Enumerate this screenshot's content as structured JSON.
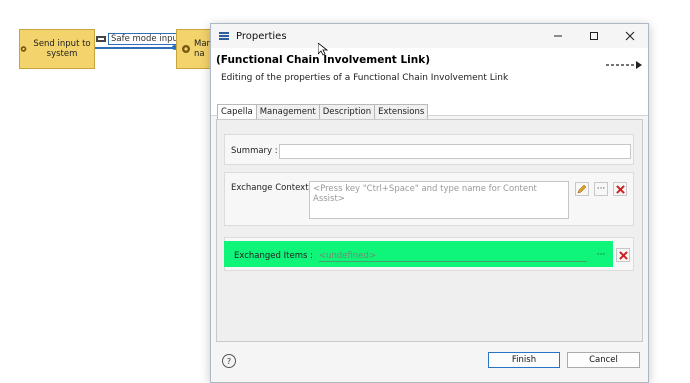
{
  "diagram": {
    "node1_label": "Send input to system",
    "node2_label": "Man\nna",
    "edge_label": "Safe mode input"
  },
  "dialog": {
    "title": "Properties",
    "header_title": "(Functional Chain Involvement Link)",
    "header_desc": "Editing of the properties of a Functional Chain Involvement Link",
    "tabs": [
      "Capella",
      "Management",
      "Description",
      "Extensions"
    ],
    "summary_label": "Summary :",
    "summary_value": "",
    "context_label": "Exchange Context :",
    "context_placeholder": "<Press key \"Ctrl+Space\" and type name for Content Assist>",
    "items_label": "Exchanged Items :",
    "items_value": "<undefined>",
    "ellipsis": "···",
    "finish_label": "Finish",
    "cancel_label": "Cancel",
    "help_label": "?"
  },
  "colors": {
    "node_fill": "#f3d36b",
    "edge": "#2f6fb9",
    "highlight": "#0ef57a",
    "delete_red": "#d02020"
  }
}
